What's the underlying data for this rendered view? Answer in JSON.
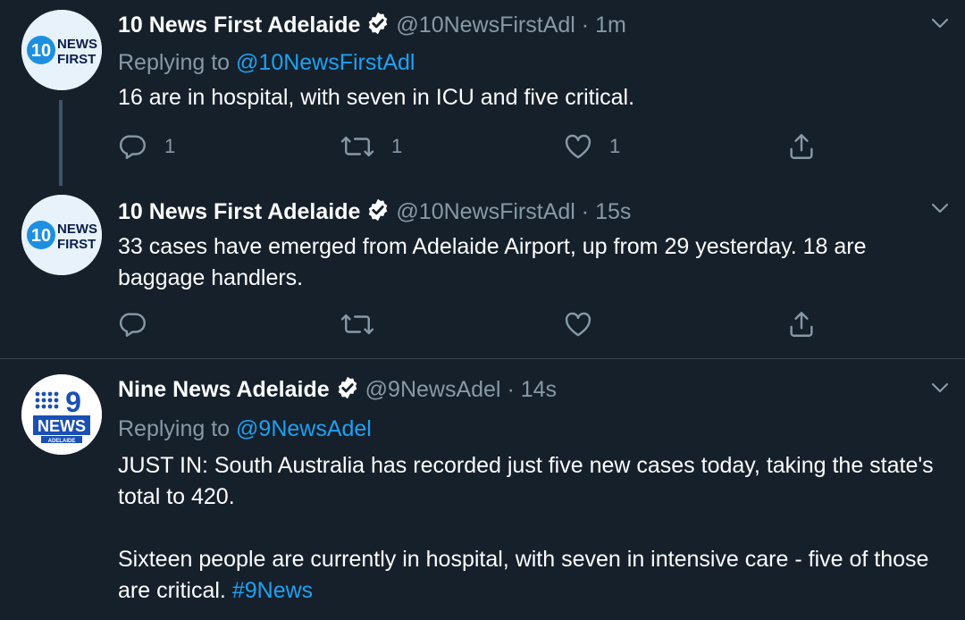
{
  "tweets": [
    {
      "name": "10 News First Adelaide",
      "handle": "@10NewsFirstAdl",
      "separator": "·",
      "time": "1m",
      "replying_prefix": "Replying to",
      "replying_to": "@10NewsFirstAdl",
      "text": "16 are in hospital, with seven in ICU and five critical.",
      "reply_count": "1",
      "retweet_count": "1",
      "like_count": "1",
      "avatar": {
        "line1": "NEWS",
        "line2": "FIRST",
        "numeral": "10"
      }
    },
    {
      "name": "10 News First Adelaide",
      "handle": "@10NewsFirstAdl",
      "separator": "·",
      "time": "15s",
      "text": "33 cases have emerged from Adelaide Airport, up from 29 yesterday. 18 are baggage handlers.",
      "avatar": {
        "line1": "NEWS",
        "line2": "FIRST",
        "numeral": "10"
      }
    },
    {
      "name": "Nine News Adelaide",
      "handle": "@9NewsAdel",
      "separator": "·",
      "time": "14s",
      "replying_prefix": "Replying to",
      "replying_to": "@9NewsAdel",
      "text_line1": "JUST IN: South Australia has recorded just five new cases today, taking the state's total to 420.",
      "text_line2": "Sixteen people are currently in hospital, with seven in intensive care - five of those are critical.",
      "hashtag": "#9News",
      "avatar": {
        "numeral": "9",
        "line1": "NEWS",
        "line2": "ADELAIDE"
      }
    }
  ],
  "colors": {
    "background": "#15202b",
    "text": "#ffffff",
    "muted": "#8899a6",
    "link": "#1da1f2",
    "divider": "#38444d"
  },
  "icons": [
    "chevron-down-icon",
    "verified-badge-icon",
    "reply-icon",
    "retweet-icon",
    "like-icon",
    "share-icon"
  ]
}
